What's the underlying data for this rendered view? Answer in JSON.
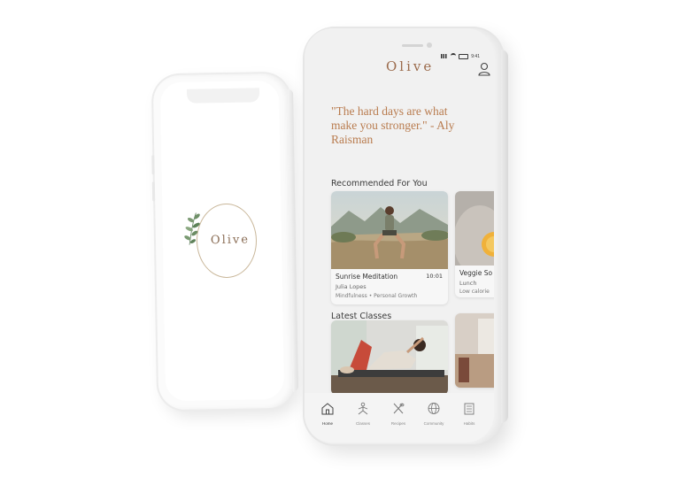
{
  "splash": {
    "logo_text": "Olive"
  },
  "home": {
    "app_title": "Olive",
    "status_time": "9:41",
    "quote": "\"The hard days are what make you stronger.\" - Aly Raisman",
    "recommended": {
      "title": "Recommended For You",
      "cards": [
        {
          "title": "Sunrise Meditation",
          "time": "10:01",
          "instructor": "Julia Lopes",
          "tags": "Mindfulness  •  Personal Growth"
        },
        {
          "title": "Veggie So",
          "subtitle": "Lunch",
          "tags": "Low calorie"
        }
      ]
    },
    "latest": {
      "title": "Latest Classes"
    },
    "tabs": [
      {
        "label": "Home",
        "icon": "home-icon",
        "active": true
      },
      {
        "label": "Classes",
        "icon": "yoga-icon",
        "active": false
      },
      {
        "label": "Recipes",
        "icon": "utensils-icon",
        "active": false
      },
      {
        "label": "Community",
        "icon": "globe-icon",
        "active": false
      },
      {
        "label": "Habits",
        "icon": "checklist-icon",
        "active": false
      }
    ],
    "colors": {
      "accent": "#b97c4f",
      "logo": "#9b6b4c"
    }
  }
}
